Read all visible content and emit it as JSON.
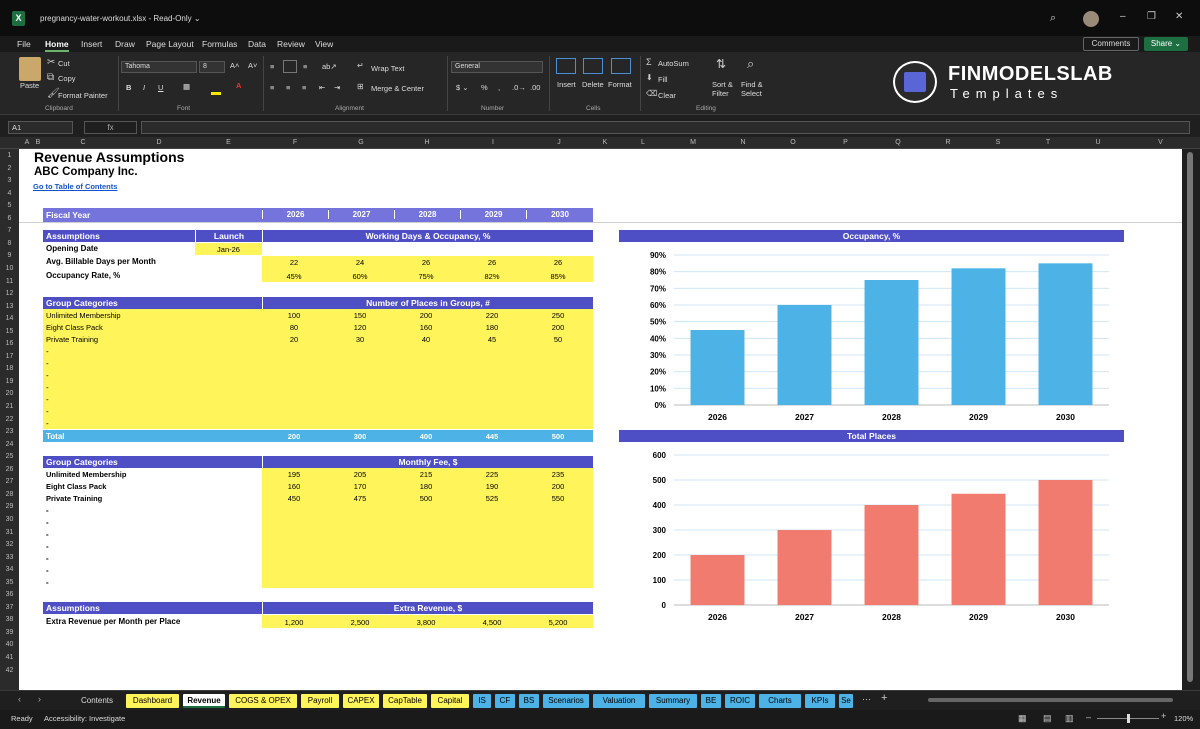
{
  "window": {
    "file_title": "pregnancy-water-workout.xlsx  -  Read-Only ⌄"
  },
  "menu": [
    "File",
    "Home",
    "Insert",
    "Draw",
    "Page Layout",
    "Formulas",
    "Data",
    "Review",
    "View"
  ],
  "buttons": {
    "comments": "Comments",
    "share": "Share ⌄"
  },
  "ribbon": {
    "paste": "Paste",
    "cut": "Cut",
    "copy": "Copy",
    "format_painter": "Format Painter",
    "font_name": "Tahoma",
    "font_size": "8",
    "wrap_text": "Wrap Text",
    "merge_center": "Merge & Center",
    "number_format": "General",
    "insert": "Insert",
    "delete": "Delete",
    "format": "Format",
    "autosum": "AutoSum",
    "fill": "Fill",
    "clear": "Clear",
    "sort_filter": "Sort & Filter",
    "find_select": "Find & Select",
    "groups": {
      "clipboard": "Clipboard",
      "font": "Font",
      "alignment": "Alignment",
      "number": "Number",
      "cells": "Cells",
      "editing": "Editing"
    }
  },
  "logo": {
    "line1": "FINMODELSLAB",
    "line2": "Templates"
  },
  "namebox": "A1",
  "fx": "fx",
  "columns": [
    "A",
    "B",
    "C",
    "D",
    "E",
    "F",
    "G",
    "H",
    "I",
    "J",
    "K",
    "L",
    "M",
    "N",
    "O",
    "P",
    "Q",
    "R",
    "S",
    "T",
    "U",
    "V"
  ],
  "rows": [
    "1",
    "2",
    "3",
    "4",
    "5",
    "6",
    "7",
    "8",
    "9",
    "10",
    "11",
    "12",
    "13",
    "14",
    "15",
    "16",
    "17",
    "18",
    "19",
    "20",
    "21",
    "22",
    "23",
    "24",
    "25",
    "26",
    "27",
    "28",
    "29",
    "30",
    "31",
    "32",
    "33",
    "34",
    "35",
    "36",
    "37",
    "38",
    "39",
    "40",
    "41",
    "42"
  ],
  "sheet": {
    "title": "Revenue Assumptions",
    "company": "ABC Company Inc.",
    "toc_link": "Go to Table of Contents",
    "fiscal_year": "Fiscal Year",
    "years": [
      "2026",
      "2027",
      "2028",
      "2029",
      "2030"
    ],
    "assumptions": "Assumptions",
    "launch": "Launch",
    "working_days_hdr": "Working Days & Occupancy, %",
    "opening_date": "Opening Date",
    "opening_date_value": "Jan-26",
    "billable_days": "Avg. Billable Days per Month",
    "billable_values": [
      "22",
      "24",
      "26",
      "26",
      "26"
    ],
    "occupancy_rate": "Occupancy Rate, %",
    "occupancy_values": [
      "45%",
      "60%",
      "75%",
      "82%",
      "85%"
    ],
    "group_categories": "Group Categories",
    "places_hdr": "Number of Places in Groups, #",
    "places_rows": [
      {
        "name": "Unlimited Membership",
        "values": [
          "100",
          "150",
          "200",
          "220",
          "250"
        ]
      },
      {
        "name": "Eight Class Pack",
        "values": [
          "80",
          "120",
          "160",
          "180",
          "200"
        ]
      },
      {
        "name": "Private Training",
        "values": [
          "20",
          "30",
          "40",
          "45",
          "50"
        ]
      }
    ],
    "dash": "-",
    "total": "Total",
    "total_values": [
      "200",
      "300",
      "400",
      "445",
      "500"
    ],
    "fee_hdr": "Monthly Fee, $",
    "fee_rows": [
      {
        "name": "Unlimited Membership",
        "values": [
          "195",
          "205",
          "215",
          "225",
          "235"
        ]
      },
      {
        "name": "Eight Class Pack",
        "values": [
          "160",
          "170",
          "180",
          "190",
          "200"
        ]
      },
      {
        "name": "Private Training",
        "values": [
          "450",
          "475",
          "500",
          "525",
          "550"
        ]
      }
    ],
    "extra_hdr": "Extra Revenue, $",
    "extra_label": "Extra Revenue per Month per Place",
    "extra_values": [
      "1,200",
      "2,500",
      "3,800",
      "4,500",
      "5,200"
    ]
  },
  "chart_data": [
    {
      "type": "bar",
      "title": "Occupancy, %",
      "categories": [
        "2026",
        "2027",
        "2028",
        "2029",
        "2030"
      ],
      "values": [
        45,
        60,
        75,
        82,
        85
      ],
      "ylim": [
        0,
        90
      ],
      "yticks": [
        "0%",
        "10%",
        "20%",
        "30%",
        "40%",
        "50%",
        "60%",
        "70%",
        "80%",
        "90%"
      ],
      "color": "#4db3e6",
      "grid": true
    },
    {
      "type": "bar",
      "title": "Total Places",
      "categories": [
        "2026",
        "2027",
        "2028",
        "2029",
        "2030"
      ],
      "values": [
        200,
        300,
        400,
        445,
        500
      ],
      "ylim": [
        0,
        600
      ],
      "yticks": [
        "0",
        "100",
        "200",
        "300",
        "400",
        "500",
        "600"
      ],
      "color": "#f07b6e",
      "grid": true
    }
  ],
  "tabs": [
    {
      "label": "Contents",
      "bg": "#1f1f1f",
      "fg": "#ddd"
    },
    {
      "label": "Dashboard",
      "bg": "#fff55a",
      "fg": "#000"
    },
    {
      "label": "Revenue",
      "bg": "#ffffff",
      "fg": "#000",
      "active": true
    },
    {
      "label": "COGS & OPEX",
      "bg": "#fff55a",
      "fg": "#000"
    },
    {
      "label": "Payroll",
      "bg": "#fff55a",
      "fg": "#000"
    },
    {
      "label": "CAPEX",
      "bg": "#fff55a",
      "fg": "#000"
    },
    {
      "label": "CapTable",
      "bg": "#fff55a",
      "fg": "#000"
    },
    {
      "label": "Capital",
      "bg": "#fff55a",
      "fg": "#000"
    },
    {
      "label": "IS",
      "bg": "#4db3e6",
      "fg": "#000"
    },
    {
      "label": "CF",
      "bg": "#4db3e6",
      "fg": "#000"
    },
    {
      "label": "BS",
      "bg": "#4db3e6",
      "fg": "#000"
    },
    {
      "label": "Scenarios",
      "bg": "#4db3e6",
      "fg": "#000"
    },
    {
      "label": "Valuation",
      "bg": "#4db3e6",
      "fg": "#000"
    },
    {
      "label": "Summary",
      "bg": "#4db3e6",
      "fg": "#000"
    },
    {
      "label": "BE",
      "bg": "#4db3e6",
      "fg": "#000"
    },
    {
      "label": "ROIC",
      "bg": "#4db3e6",
      "fg": "#000"
    },
    {
      "label": "Charts",
      "bg": "#4db3e6",
      "fg": "#000"
    },
    {
      "label": "KPIs",
      "bg": "#4db3e6",
      "fg": "#000"
    },
    {
      "label": "Se",
      "bg": "#4db3e6",
      "fg": "#000"
    }
  ],
  "status": {
    "ready": "Ready",
    "accessibility": "Accessibility: Investigate",
    "zoom": "120%"
  }
}
